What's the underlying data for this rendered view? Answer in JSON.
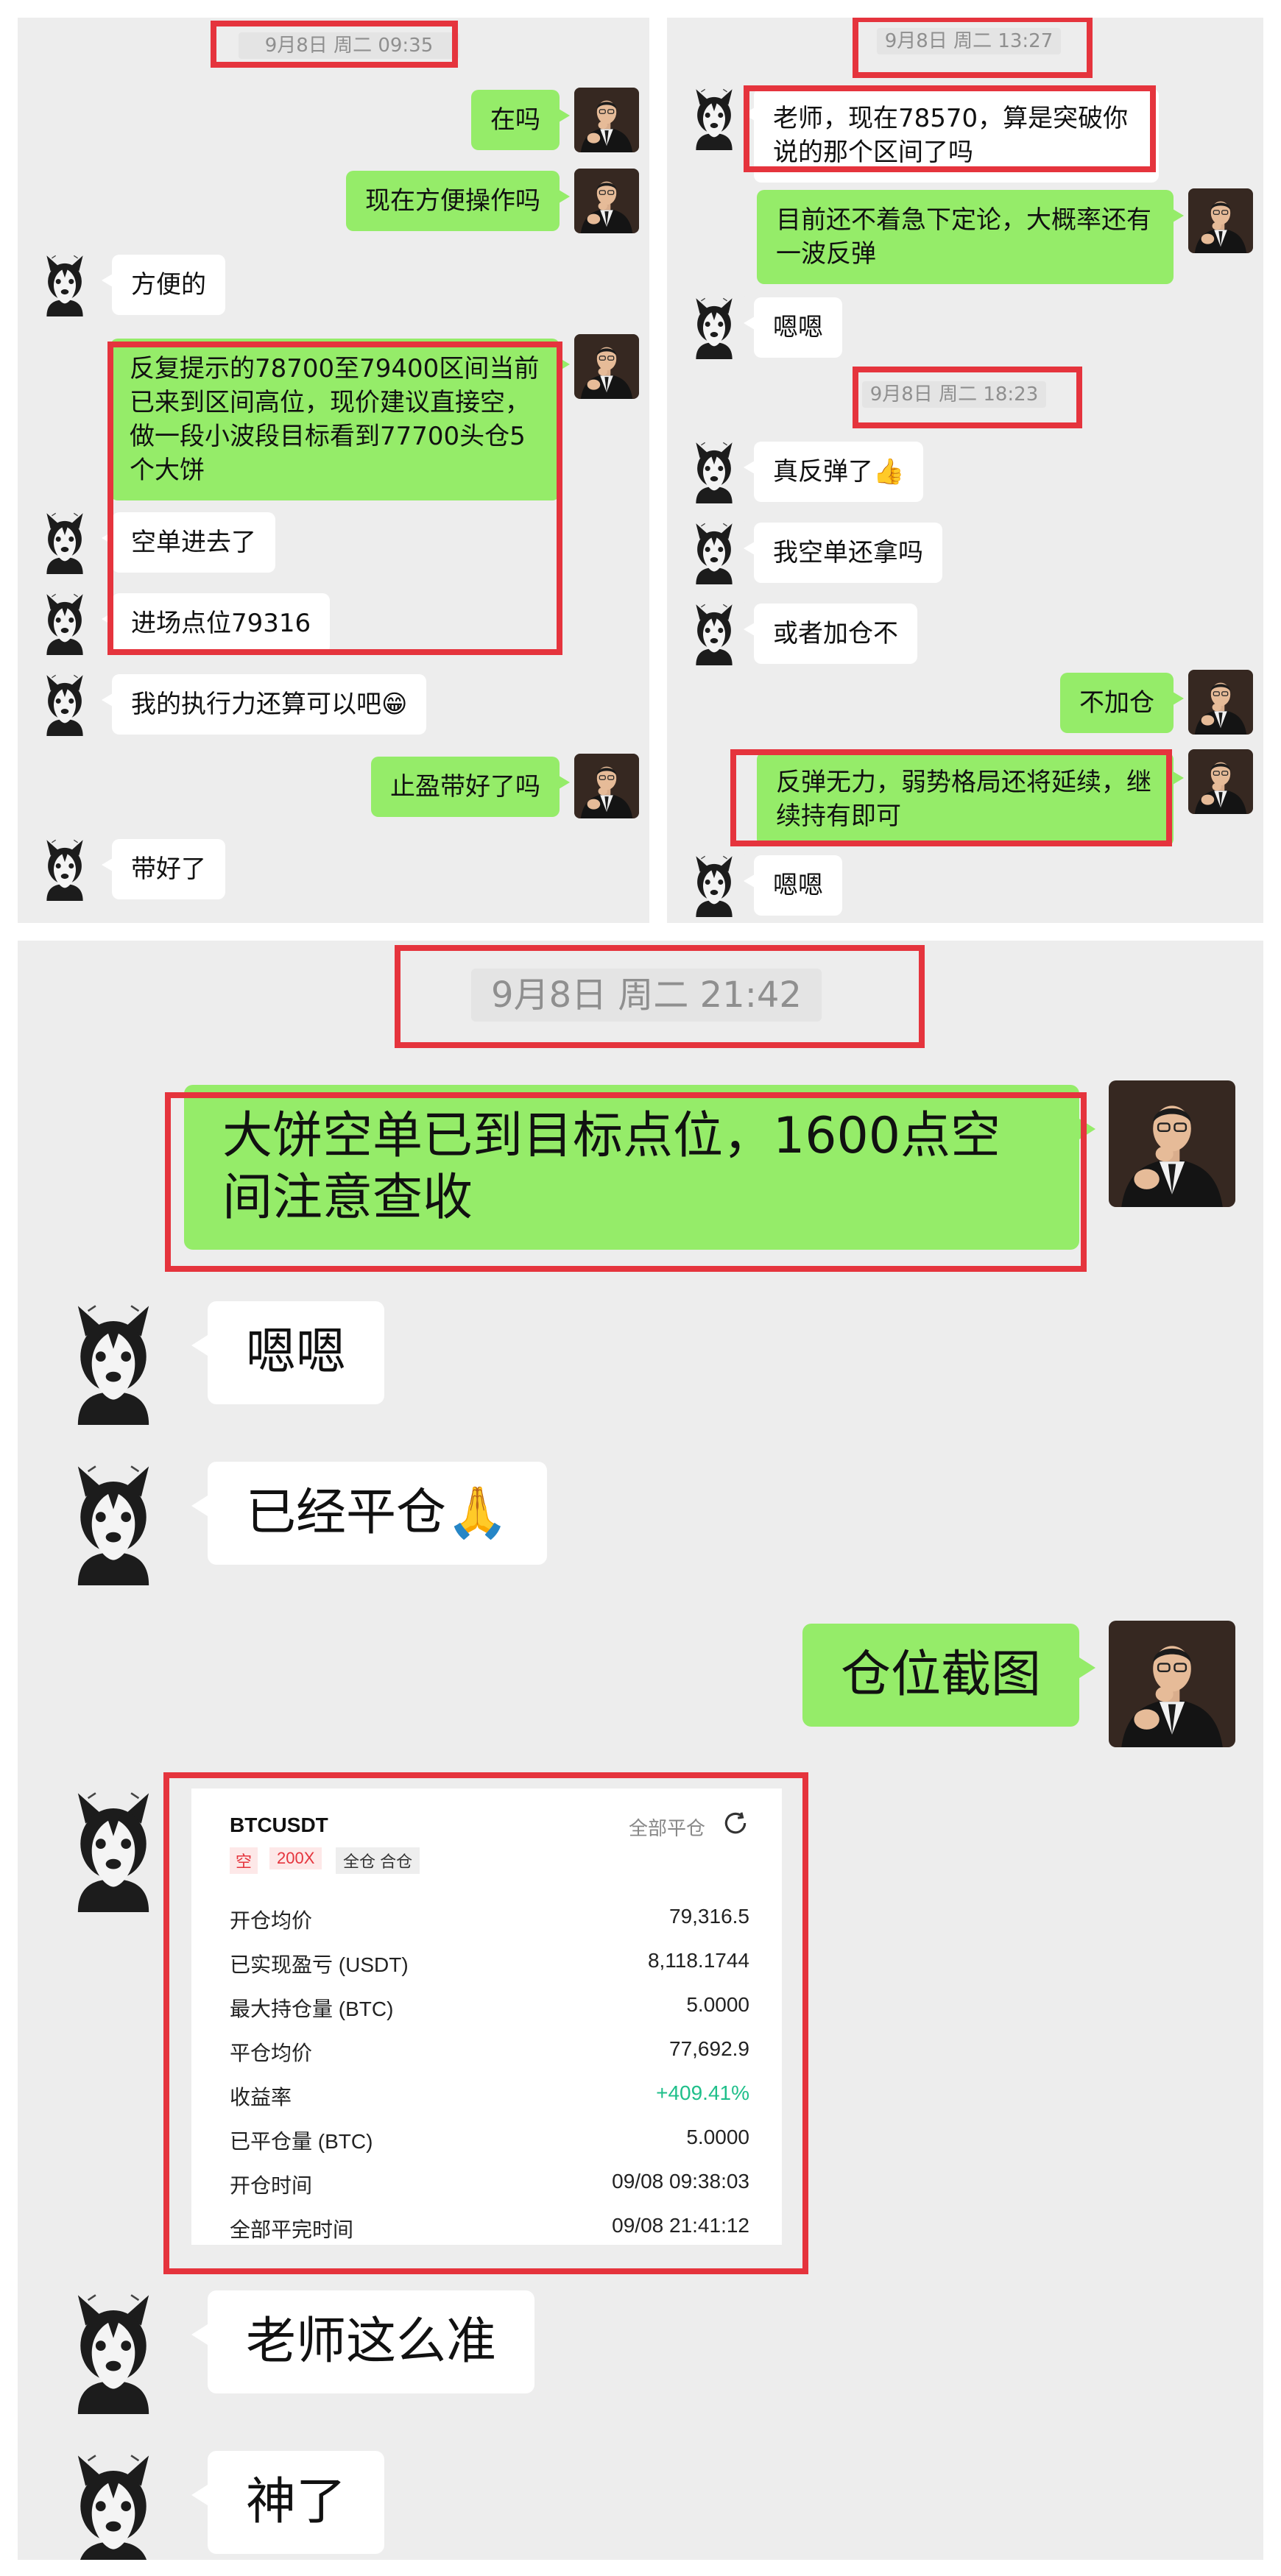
{
  "panel1": {
    "timestamp": "9月8日 周二 09:35",
    "messages": [
      {
        "side": "right",
        "text": "在吗"
      },
      {
        "side": "right",
        "text": "现在方便操作吗"
      },
      {
        "side": "left",
        "text": "方便的"
      },
      {
        "side": "right",
        "text": "反复提示的78700至79400区间当前已来到区间高位，现价建议直接空，做一段小波段目标看到77700头仓5个大饼"
      },
      {
        "side": "left",
        "text": "空单进去了"
      },
      {
        "side": "left",
        "text": "进场点位79316"
      },
      {
        "side": "left",
        "text": "我的执行力还算可以吧😁"
      },
      {
        "side": "right",
        "text": "止盈带好了吗"
      },
      {
        "side": "left",
        "text": "带好了"
      }
    ]
  },
  "panel2": {
    "timestamp1": "9月8日 周二 13:27",
    "timestamp2": "9月8日 周二 18:23",
    "messages": [
      {
        "side": "left",
        "text": "老师，现在78570，算是突破你说的那个区间了吗"
      },
      {
        "side": "right",
        "text": "目前还不着急下定论，大概率还有一波反弹"
      },
      {
        "side": "left",
        "text": "嗯嗯"
      },
      {
        "side": "left",
        "text": "真反弹了👍"
      },
      {
        "side": "left",
        "text": "我空单还拿吗"
      },
      {
        "side": "left",
        "text": "或者加仓不"
      },
      {
        "side": "right",
        "text": "不加仓"
      },
      {
        "side": "right",
        "text": "反弹无力，弱势格局还将延续，继续持有即可"
      },
      {
        "side": "left",
        "text": "嗯嗯"
      }
    ]
  },
  "panel3": {
    "timestamp": "9月8日 周二 21:42",
    "messages": [
      {
        "side": "right",
        "text": "大饼空单已到目标点位，1600点空间注意查收"
      },
      {
        "side": "left",
        "text": "嗯嗯"
      },
      {
        "side": "left",
        "text": "已经平仓🙏"
      },
      {
        "side": "right",
        "text": "仓位截图"
      },
      {
        "side": "left",
        "text": "老师这么准"
      },
      {
        "side": "left",
        "text": "神了"
      }
    ]
  },
  "position_card": {
    "symbol": "BTCUSDT",
    "action_label": "全部平仓",
    "share_icon": "share-icon",
    "tag_side": "空",
    "tag_leverage": "200X",
    "tag_mode": "全仓 合仓",
    "rows": [
      {
        "label": "开仓均价",
        "value": "79,316.5"
      },
      {
        "label": "已实现盈亏 (USDT)",
        "value": "8,118.1744"
      },
      {
        "label": "最大持仓量 (BTC)",
        "value": "5.0000"
      },
      {
        "label": "平仓均价",
        "value": "77,692.9"
      },
      {
        "label": "收益率",
        "value": "+409.41%"
      },
      {
        "label": "已平仓量 (BTC)",
        "value": "5.0000"
      },
      {
        "label": "开仓时间",
        "value": "09/08 09:38:03"
      },
      {
        "label": "全部平完时间",
        "value": "09/08 21:41:12"
      }
    ]
  },
  "colors": {
    "bubble_green": "#95ec69",
    "highlight_red": "#e5343d",
    "profit_green": "#1fbf8a"
  },
  "icons": {
    "dog_avatar": "husky-avatar",
    "teacher_avatar": "man-in-suit-avatar"
  }
}
